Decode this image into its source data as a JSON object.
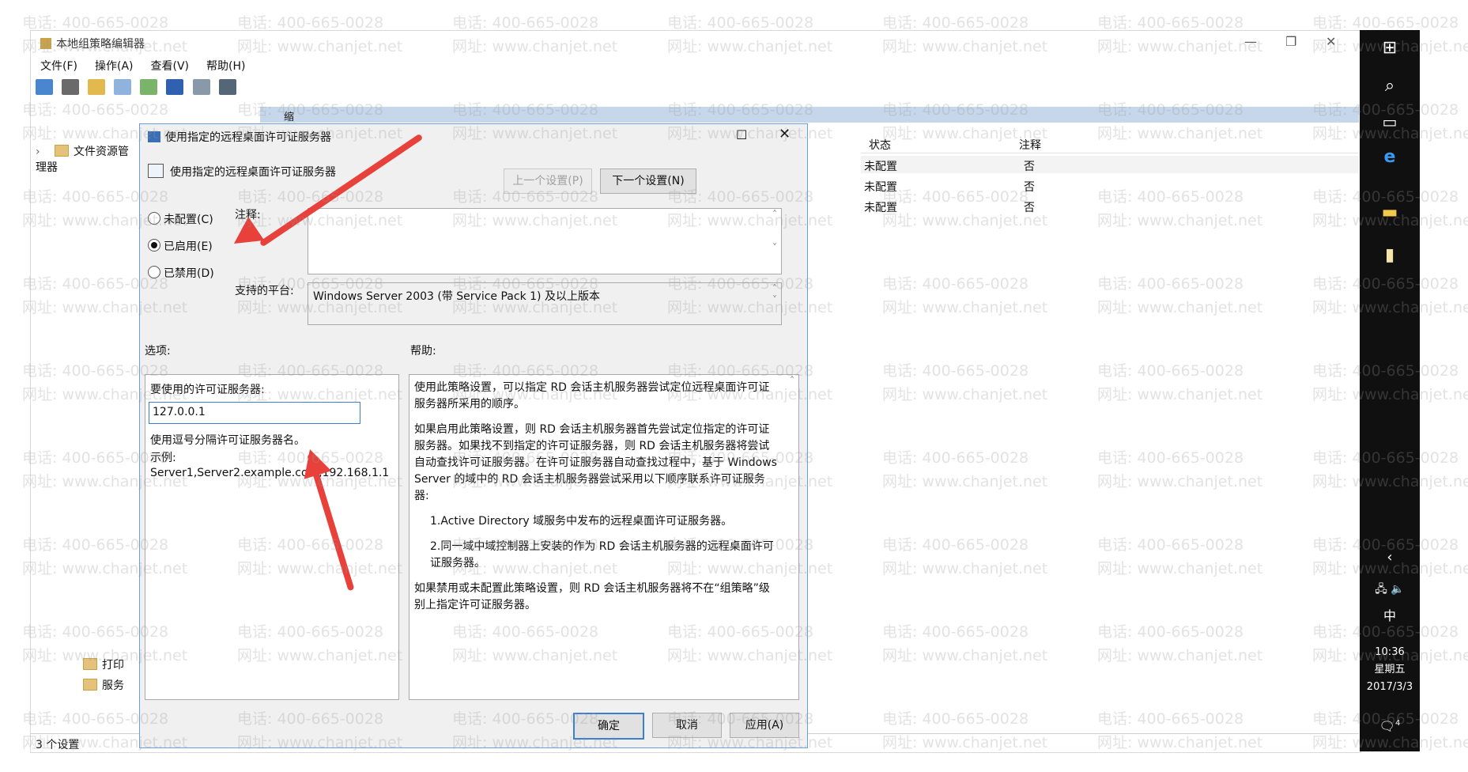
{
  "window": {
    "title": "本地组策略编辑器",
    "menu": [
      "文件(F)",
      "操作(A)",
      "查看(V)",
      "帮助(H)"
    ]
  },
  "tree": {
    "top_item": "文件资源管理器",
    "bottom_items": [
      "打印",
      "服务"
    ]
  },
  "table": {
    "header_partial": "缩",
    "columns": [
      "状态",
      "注释"
    ],
    "rows": [
      {
        "status": "未配置",
        "comment": "否"
      },
      {
        "status": "未配置",
        "comment": "否"
      },
      {
        "status": "未配置",
        "comment": "否"
      }
    ]
  },
  "status_bar": "3 个设置",
  "dialog": {
    "title": "使用指定的远程桌面许可证服务器",
    "header": "使用指定的远程桌面许可证服务器",
    "prev_button": "上一个设置(P)",
    "next_button": "下一个设置(N)",
    "radio_not_configured": "未配置(C)",
    "radio_enabled": "已启用(E)",
    "radio_disabled": "已禁用(D)",
    "comment_label": "注释:",
    "platform_label": "支持的平台:",
    "platform_value": "Windows Server 2003 (带 Service Pack 1) 及以上版本",
    "options_label": "选项:",
    "help_label": "帮助:",
    "license_server_label": "要使用的许可证服务器:",
    "license_server_value": "127.0.0.1",
    "hint_line": "使用逗号分隔许可证服务器名。",
    "example_label": "示例:",
    "example_value": "Server1,Server2.example.com,192.168.1.1",
    "help_paragraphs": [
      "使用此策略设置，可以指定 RD 会话主机服务器尝试定位远程桌面许可证服务器所采用的顺序。",
      "如果启用此策略设置，则 RD 会话主机服务器首先尝试定位指定的许可证服务器。如果找不到指定的许可证服务器，则 RD 会话主机服务器将尝试自动查找许可证服务器。在许可证服务器自动查找过程中，基于 Windows Server 的域中的 RD 会话主机服务器尝试采用以下顺序联系许可证服务器:",
      "1.Active Directory 域服务中发布的远程桌面许可证服务器。",
      "2.同一域中域控制器上安装的作为 RD 会话主机服务器的远程桌面许可证服务器。",
      "如果禁用或未配置此策略设置，则 RD 会话主机服务器将不在“组策略”级别上指定许可证服务器。"
    ],
    "ok_button": "确定",
    "cancel_button": "取消",
    "apply_button": "应用(A)"
  },
  "taskbar": {
    "ime": "中",
    "time": "10:36",
    "weekday": "星期五",
    "date": "2017/3/3",
    "notification_count": "4"
  },
  "watermark": {
    "phone": "电话: 400-665-0028",
    "site": "网址: www.chanjet.net"
  },
  "colors": {
    "arrow": "#e8403a",
    "dialog_border": "#6a9fd8",
    "taskbar": "#101010",
    "selection_band": "#c7d7eb"
  }
}
